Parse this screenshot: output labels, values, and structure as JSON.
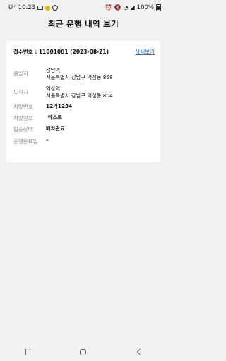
{
  "status_bar": {
    "carrier": "U⁺",
    "time": "10:23",
    "battery": "100%"
  },
  "page": {
    "title": "최근 운행 내역 보기"
  },
  "card": {
    "receipt": "접수번호 : 11001001 (2023-08-21)",
    "detail_link": "상세보기",
    "departure": {
      "label": "출발지",
      "name": "강남역",
      "address": "서울특별시 강남구 역삼동 858"
    },
    "arrival": {
      "label": "도착지",
      "name": "역삼역",
      "address": "서울특별시 강남구 역삼동 804"
    },
    "vehicle_number": {
      "label": "차량번호",
      "value": "12가1234"
    },
    "vehicle_info": {
      "label": "차량정보",
      "value": "테스트"
    },
    "boarding_status": {
      "label": "탑승상태",
      "value": "배차완료"
    },
    "completion_date": {
      "label": "운행완료일",
      "value": "*"
    }
  },
  "icons": {
    "recents": "recents-icon",
    "home": "home-icon",
    "back": "back-icon"
  }
}
